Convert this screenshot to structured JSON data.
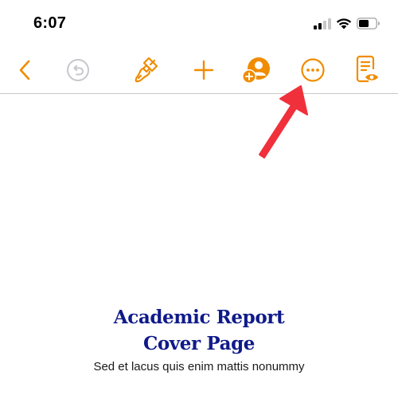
{
  "status_bar": {
    "time": "6:07",
    "icons": [
      "cellular-signal-icon",
      "wifi-icon",
      "battery-icon"
    ]
  },
  "toolbar": {
    "accent_color": "#F08C00",
    "disabled_color": "#C7C7CC",
    "buttons": [
      {
        "name": "back-button",
        "icon": "chevron-left-icon"
      },
      {
        "name": "undo-button",
        "icon": "undo-icon",
        "disabled": true
      },
      {
        "name": "format-button",
        "icon": "paintbrush-icon"
      },
      {
        "name": "insert-button",
        "icon": "plus-icon"
      },
      {
        "name": "collaborate-button",
        "icon": "add-person-icon"
      },
      {
        "name": "more-button",
        "icon": "ellipsis-circle-icon"
      },
      {
        "name": "reading-view-button",
        "icon": "document-eye-icon"
      }
    ]
  },
  "annotation": {
    "icon": "red-arrow-icon",
    "color": "#F0303A"
  },
  "document": {
    "title_line1": "Academic Report",
    "title_line2": "Cover Page",
    "title_color": "#0F1A8A",
    "subtitle": "Sed et lacus quis enim mattis nonummy"
  }
}
